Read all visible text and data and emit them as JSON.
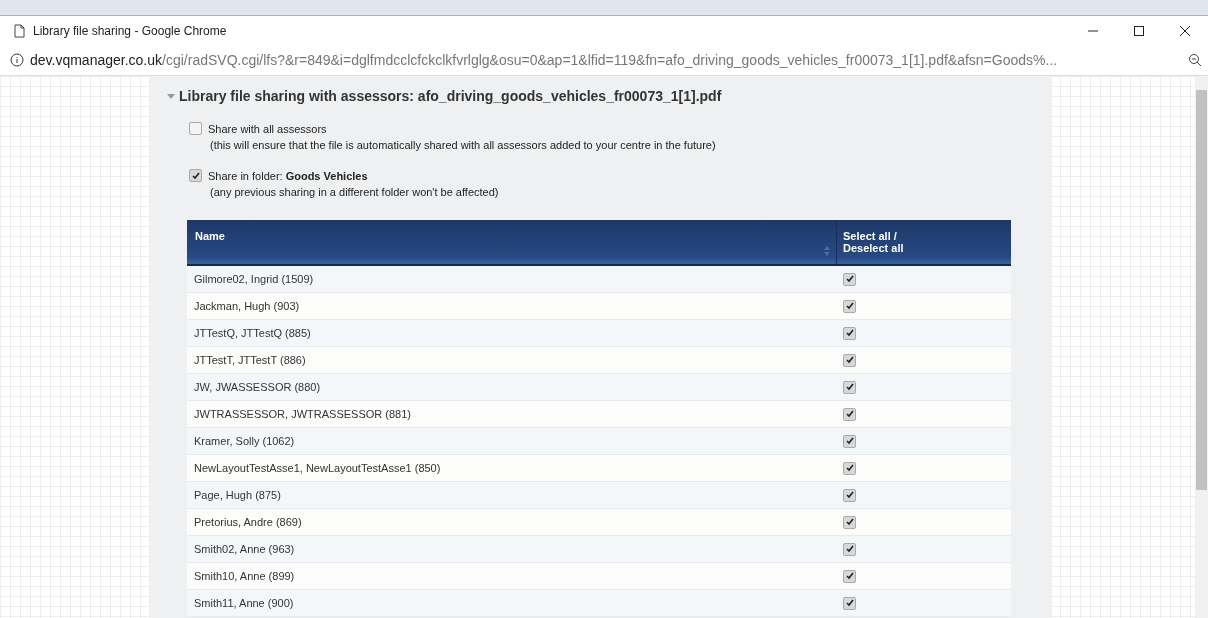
{
  "window": {
    "title": "Library file sharing - Google Chrome"
  },
  "address_bar": {
    "host": "dev.vqmanager.co.uk",
    "path": "/cgi/radSVQ.cgi/lfs?&r=849&i=dglfmdcclcfckclkfvrlglg&osu=0&ap=1&lfid=119&fn=afo_driving_goods_vehicles_fr00073_1[1].pdf&afsn=Goods%..."
  },
  "panel": {
    "heading": "Library file sharing with assessors: afo_driving_goods_vehicles_fr00073_1[1].pdf",
    "expanded": true
  },
  "options": [
    {
      "label": "Share with all assessors",
      "note": "(this will ensure that the file is automatically shared with all assessors added to your centre in the future)",
      "checked": false
    },
    {
      "label": "Share in folder: **Goods Vehicles**",
      "note": "(any previous sharing in a different folder won't be affected)",
      "checked": true
    }
  ],
  "table": {
    "columns": [
      "Name",
      "Select all / Deselect all"
    ],
    "rows": [
      {
        "name": "Gilmore02, Ingrid (1509)",
        "checked": true
      },
      {
        "name": "Jackman, Hugh (903)",
        "checked": true
      },
      {
        "name": "JTTestQ, JTTestQ (885)",
        "checked": true
      },
      {
        "name": "JTTestT, JTTestT (886)",
        "checked": true
      },
      {
        "name": "JW, JWASSESSOR (880)",
        "checked": true
      },
      {
        "name": "JWTRASSESSOR, JWTRASSESSOR (881)",
        "checked": true
      },
      {
        "name": "Kramer, Solly (1062)",
        "checked": true
      },
      {
        "name": "NewLayoutTestAsse1, NewLayoutTestAsse1 (850)",
        "checked": true
      },
      {
        "name": "Page, Hugh (875)",
        "checked": true
      },
      {
        "name": "Pretorius, Andre (869)",
        "checked": true
      },
      {
        "name": "Smith02, Anne (963)",
        "checked": true
      },
      {
        "name": "Smith10, Anne (899)",
        "checked": true
      },
      {
        "name": "Smith11, Anne (900)",
        "checked": true
      }
    ]
  }
}
